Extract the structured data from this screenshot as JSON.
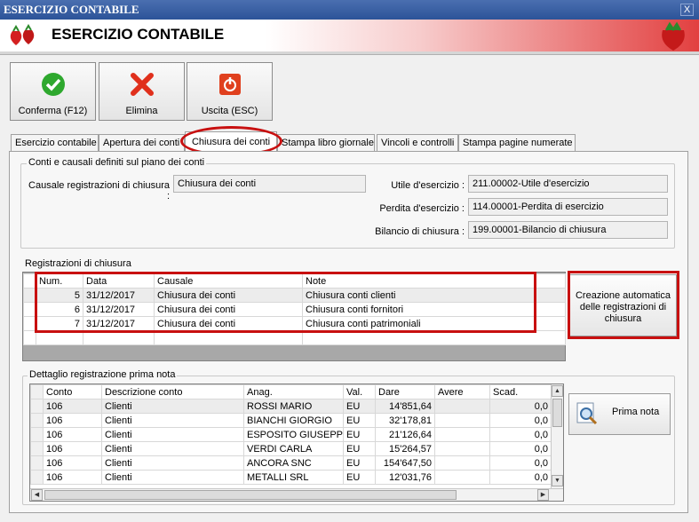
{
  "window": {
    "title": "ESERCIZIO CONTABILE",
    "close": "X"
  },
  "header": {
    "title": "ESERCIZIO CONTABILE"
  },
  "toolbar": {
    "confirm": "Conferma (F12)",
    "delete": "Elimina",
    "exit": "Uscita (ESC)"
  },
  "tabs": [
    "Esercizio contabile",
    "Apertura dei conti",
    "Chiusura dei conti",
    "Stampa libro giornale",
    "Vincoli e controlli",
    "Stampa pagine numerate"
  ],
  "accounts": {
    "legend": "Conti e causali definiti sul piano dei conti",
    "causale_label": "Causale registrazioni di chiusura :",
    "causale_value": "Chiusura dei conti",
    "utile_label": "Utile d'esercizio :",
    "utile_value": "211.00002-Utile d'esercizio",
    "perdita_label": "Perdita d'esercizio :",
    "perdita_value": "114.00001-Perdita di esercizio",
    "bilancio_label": "Bilancio di chiusura :",
    "bilancio_value": "199.00001-Bilancio di chiusura"
  },
  "registrazioni": {
    "legend": "Registrazioni di chiusura",
    "headers": [
      "Num.",
      "Data",
      "Causale",
      "Note"
    ],
    "rows": [
      [
        "5",
        "31/12/2017",
        "Chiusura dei conti",
        "Chiusura conti clienti"
      ],
      [
        "6",
        "31/12/2017",
        "Chiusura dei conti",
        "Chiusura conti fornitori"
      ],
      [
        "7",
        "31/12/2017",
        "Chiusura dei conti",
        "Chiusura conti patrimoniali"
      ]
    ],
    "auto_button": "Creazione automatica delle registrazioni di chiusura"
  },
  "dettaglio": {
    "legend": "Dettaglio registrazione prima nota",
    "headers": [
      "Conto",
      "Descrizione conto",
      "Anag.",
      "Val.",
      "Dare",
      "Avere",
      "Scad."
    ],
    "rows": [
      [
        "106",
        "Clienti",
        "ROSSI MARIO",
        "EU",
        "14'851,64",
        "",
        "0,0"
      ],
      [
        "106",
        "Clienti",
        "BIANCHI GIORGIO",
        "EU",
        "32'178,81",
        "",
        "0,0"
      ],
      [
        "106",
        "Clienti",
        "ESPOSITO GIUSEPPE",
        "EU",
        "21'126,64",
        "",
        "0,0"
      ],
      [
        "106",
        "Clienti",
        "VERDI CARLA",
        "EU",
        "15'264,57",
        "",
        "0,0"
      ],
      [
        "106",
        "Clienti",
        "ANCORA SNC",
        "EU",
        "154'647,50",
        "",
        "0,0"
      ],
      [
        "106",
        "Clienti",
        "METALLI SRL",
        "EU",
        "12'031,76",
        "",
        "0,0"
      ]
    ],
    "prima_nota_button": "Prima nota"
  }
}
